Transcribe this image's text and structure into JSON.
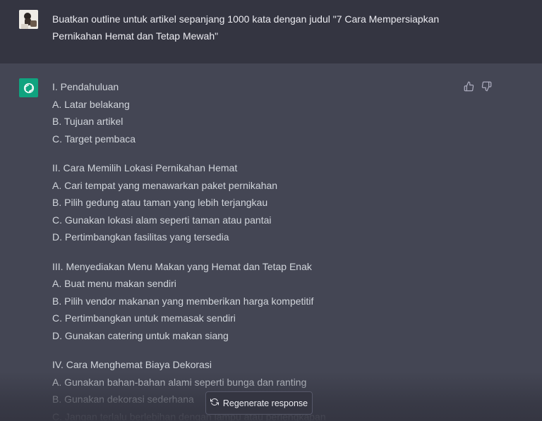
{
  "user_message": {
    "line1": "Buatkan outline untuk artikel sepanjang 1000 kata dengan judul \"7 Cara Mempersiapkan",
    "line2": "Pernikahan Hemat dan Tetap Mewah\""
  },
  "answer": {
    "sections": [
      {
        "heading": "I. Pendahuluan",
        "items": [
          "A. Latar belakang",
          "B. Tujuan artikel",
          "C. Target pembaca"
        ]
      },
      {
        "heading": "II. Cara Memilih Lokasi Pernikahan Hemat",
        "items": [
          "A. Cari tempat yang menawarkan paket pernikahan",
          "B. Pilih gedung atau taman yang lebih terjangkau",
          "C. Gunakan lokasi alam seperti taman atau pantai",
          "D. Pertimbangkan fasilitas yang tersedia"
        ]
      },
      {
        "heading": "III. Menyediakan Menu Makan yang Hemat dan Tetap Enak",
        "items": [
          "A. Buat menu makan sendiri",
          "B. Pilih vendor makanan yang memberikan harga kompetitif",
          "C. Pertimbangkan untuk memasak sendiri",
          "D. Gunakan catering untuk makan siang"
        ]
      },
      {
        "heading": "IV. Cara Menghemat Biaya Dekorasi",
        "items": [
          "A. Gunakan bahan-bahan alami seperti bunga dan ranting",
          "B. Gunakan dekorasi sederhana",
          "C. Jangan terlalu berlebihan dengan lampu atau perlengkapan"
        ]
      }
    ]
  },
  "buttons": {
    "regenerate_label": "Regenerate response"
  },
  "icons": {
    "avatar": "user-avatar",
    "assistant": "openai-logo-icon",
    "thumbs_up": "thumbs-up-icon",
    "thumbs_down": "thumbs-down-icon",
    "regenerate": "refresh-icon"
  },
  "colors": {
    "user_bg": "#343541",
    "assistant_bg": "#444654",
    "brand": "#10a37f",
    "text": "#d1d5db"
  }
}
